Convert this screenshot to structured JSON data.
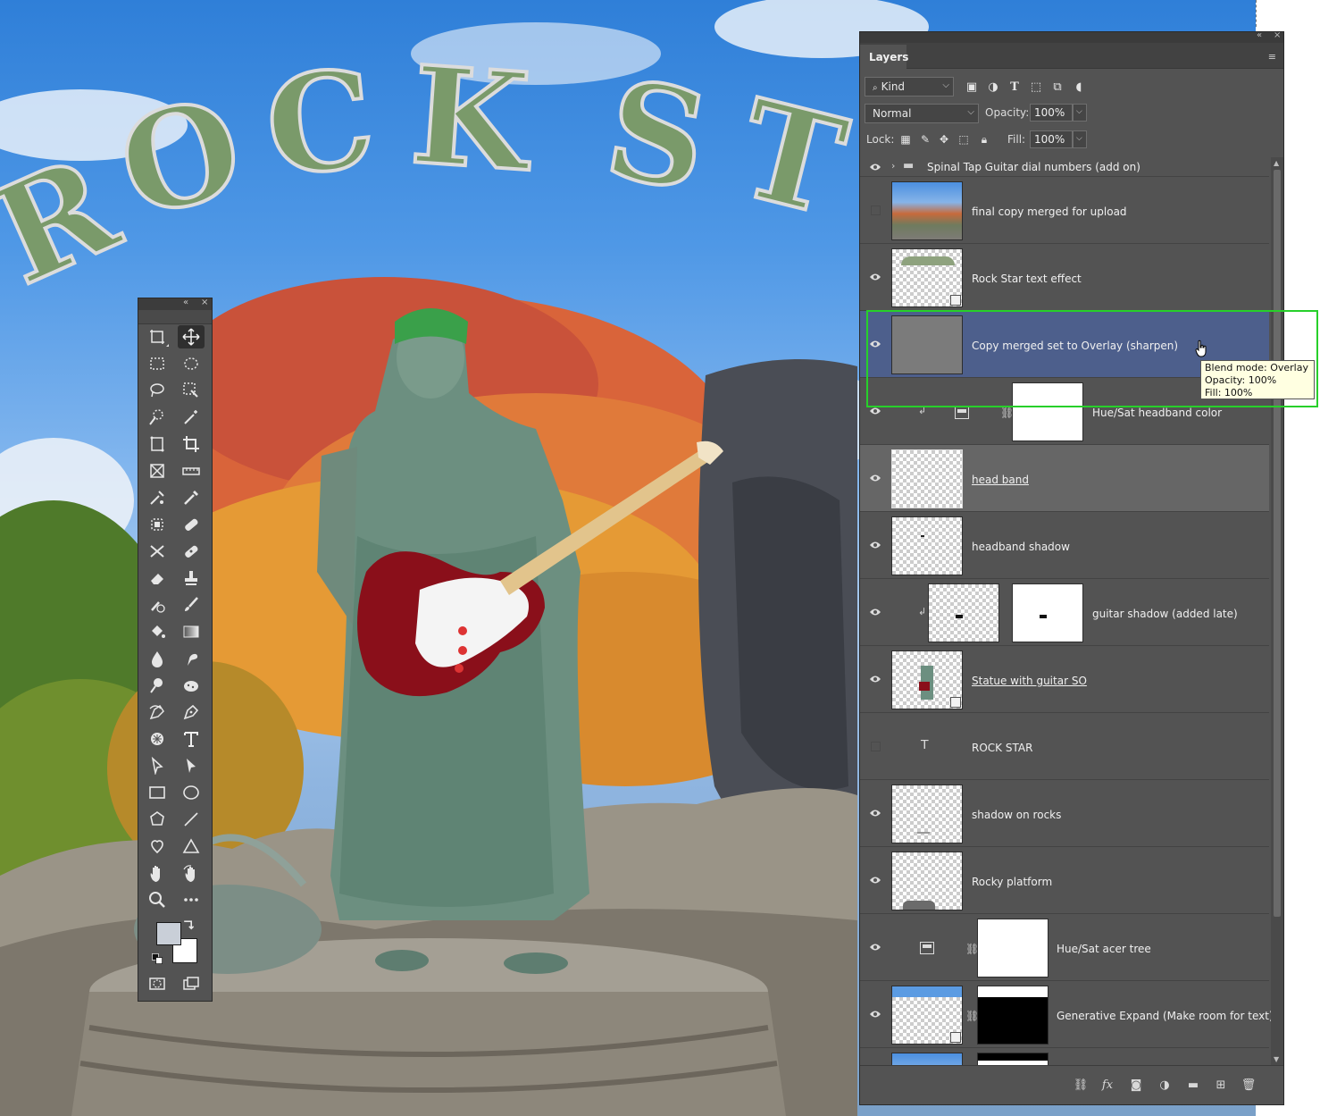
{
  "canvas": {
    "title_text": "ROCK STA"
  },
  "tools_panel": {
    "collapse_glyph": "«",
    "close_glyph": "×",
    "foreground_color": "#c9cfd8",
    "background_color": "#ffffff"
  },
  "layers_panel": {
    "tab_label": "Layers",
    "collapse_glyph": "«",
    "close_glyph": "×",
    "menu_glyph": "≡",
    "filter": {
      "kind_label": "Kind"
    },
    "blend_mode": "Normal",
    "opacity_label": "Opacity:",
    "opacity_value": "100%",
    "lock_label": "Lock:",
    "fill_label": "Fill:",
    "fill_value": "100%",
    "layers": [
      {
        "name": "Spinal Tap Guitar dial numbers (add on)",
        "type": "group",
        "visible": true
      },
      {
        "name": "final copy merged for upload",
        "type": "pixel",
        "visible": false
      },
      {
        "name": "Rock Star text effect",
        "type": "smart-object",
        "visible": true
      },
      {
        "name": "Copy merged set to Overlay (sharpen)",
        "type": "pixel",
        "visible": true,
        "selected": true
      },
      {
        "name": "Hue/Sat headband color",
        "type": "adjustment",
        "visible": true,
        "clipped": true
      },
      {
        "name": "head band",
        "type": "pixel",
        "visible": true,
        "hovered": true
      },
      {
        "name": "headband shadow",
        "type": "pixel",
        "visible": true
      },
      {
        "name": "guitar shadow (added late)",
        "type": "pixel-mask",
        "visible": true,
        "clipped": true
      },
      {
        "name": "Statue with guitar SO",
        "type": "smart-object",
        "visible": true
      },
      {
        "name": "ROCK STAR",
        "type": "text",
        "visible": false
      },
      {
        "name": "shadow on rocks",
        "type": "pixel",
        "visible": true
      },
      {
        "name": "Rocky platform",
        "type": "pixel",
        "visible": true
      },
      {
        "name": "Hue/Sat acer tree",
        "type": "adjustment",
        "visible": true
      },
      {
        "name": "Generative Expand (Make room for text)",
        "type": "generative",
        "visible": true
      }
    ],
    "tooltip": {
      "line1": "Blend mode: Overlay",
      "line2": "Opacity: 100%",
      "line3": "Fill: 100%"
    },
    "footer_icons": [
      "link-icon",
      "fx-icon",
      "mask-icon",
      "adjustment-icon",
      "folder-icon",
      "new-layer-icon",
      "trash-icon"
    ],
    "fx_label": "fx"
  }
}
